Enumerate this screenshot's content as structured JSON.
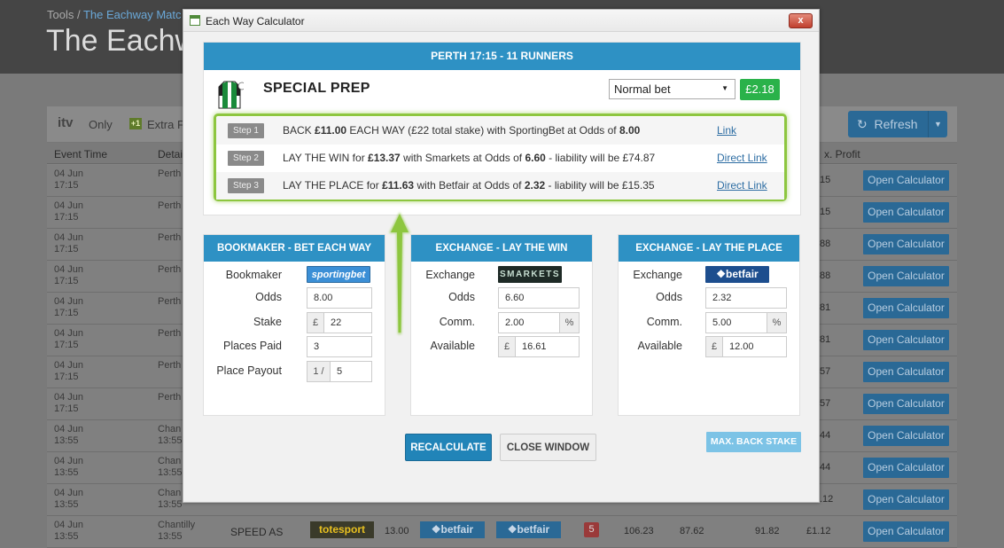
{
  "page": {
    "breadcrumb_root": "Tools",
    "breadcrumb_sep": " / ",
    "breadcrumb_current": "The Eachway Matc",
    "title": "The Eachwa"
  },
  "toolbar": {
    "itv_logo": "itv",
    "itv_only": "Only",
    "extra_badge": "+1",
    "extra_label": "Extra F",
    "refresh_label": "Refresh"
  },
  "table": {
    "headers": [
      "Event Time",
      "Detail",
      "x. Profit"
    ],
    "rows": [
      {
        "date": "04 Jun",
        "time": "17:15",
        "detail1": "Perth",
        "detail2": "",
        "profit": "15",
        "action": "Open Calculator"
      },
      {
        "date": "04 Jun",
        "time": "17:15",
        "detail1": "Perth",
        "detail2": "",
        "profit": "15",
        "action": "Open Calculator"
      },
      {
        "date": "04 Jun",
        "time": "17:15",
        "detail1": "Perth",
        "detail2": "",
        "profit": "88",
        "action": "Open Calculator"
      },
      {
        "date": "04 Jun",
        "time": "17:15",
        "detail1": "Perth",
        "detail2": "",
        "profit": "88",
        "action": "Open Calculator"
      },
      {
        "date": "04 Jun",
        "time": "17:15",
        "detail1": "Perth",
        "detail2": "",
        "profit": "81",
        "action": "Open Calculator"
      },
      {
        "date": "04 Jun",
        "time": "17:15",
        "detail1": "Perth",
        "detail2": "",
        "profit": "81",
        "action": "Open Calculator"
      },
      {
        "date": "04 Jun",
        "time": "17:15",
        "detail1": "Perth",
        "detail2": "",
        "profit": "57",
        "action": "Open Calculator"
      },
      {
        "date": "04 Jun",
        "time": "17:15",
        "detail1": "Perth",
        "detail2": "",
        "profit": "57",
        "action": "Open Calculator"
      },
      {
        "date": "04 Jun",
        "time": "13:55",
        "detail1": "Chan",
        "detail2": "13:55",
        "profit": "44",
        "action": "Open Calculator"
      },
      {
        "date": "04 Jun",
        "time": "13:55",
        "detail1": "Chan",
        "detail2": "13:55",
        "profit": "44",
        "action": "Open Calculator"
      },
      {
        "date": "04 Jun",
        "time": "13:55",
        "detail1": "Chan",
        "detail2": "13:55",
        "profit": ".12",
        "action": "Open Calculator"
      }
    ],
    "last_row": {
      "date": "04 Jun",
      "time": "13:55",
      "course": "Chantilly",
      "course_time": "13:55",
      "horse": "SPEED AS",
      "bookie": "totesport",
      "odds": "13.00",
      "ex1": "betfair",
      "ex2": "betfair",
      "places": "5",
      "v1": "106.23",
      "v2": "87.62",
      "v3": "91.82",
      "profit": "£1.12",
      "action": "Open Calculator"
    }
  },
  "modal": {
    "title": "Each Way Calculator",
    "close": "x",
    "race": "PERTH 17:15  -  11 RUNNERS",
    "horse": "SPECIAL PREP",
    "bet_type": "Normal bet",
    "profit": "£2.18",
    "steps": [
      {
        "label": "Step 1",
        "pre": "BACK ",
        "b1": "£11.00",
        "mid1": " EACH WAY (£22 total stake) with SportingBet at Odds of ",
        "b2": "8.00",
        "post": "",
        "link": "Link"
      },
      {
        "label": "Step 2",
        "pre": "LAY THE WIN for ",
        "b1": "£13.37",
        "mid1": " with Smarkets at Odds of ",
        "b2": "6.60",
        "post": " - liability will be £74.87",
        "link": "Direct Link"
      },
      {
        "label": "Step 3",
        "pre": "LAY THE PLACE for ",
        "b1": "£11.63",
        "mid1": " with Betfair at Odds of ",
        "b2": "2.32",
        "post": " - liability will be £15.35",
        "link": "Direct Link"
      }
    ],
    "bookmaker_panel": {
      "header": "BOOKMAKER - BET EACH WAY",
      "bookmaker_label": "Bookmaker",
      "bookmaker_logo": "sportingbet",
      "odds_label": "Odds",
      "odds_value": "8.00",
      "stake_label": "Stake",
      "stake_prefix": "£",
      "stake_value": "22",
      "places_label": "Places Paid",
      "places_value": "3",
      "payout_label": "Place Payout",
      "payout_prefix": "1 /",
      "payout_value": "5"
    },
    "win_panel": {
      "header": "EXCHANGE - LAY THE WIN",
      "exchange_label": "Exchange",
      "exchange_logo": "SMARKETS",
      "odds_label": "Odds",
      "odds_value": "6.60",
      "comm_label": "Comm.",
      "comm_value": "2.00",
      "comm_suffix": "%",
      "avail_label": "Available",
      "avail_prefix": "£",
      "avail_value": "16.61"
    },
    "place_panel": {
      "header": "EXCHANGE - LAY THE PLACE",
      "exchange_label": "Exchange",
      "exchange_logo": "betfair",
      "odds_label": "Odds",
      "odds_value": "2.32",
      "comm_label": "Comm.",
      "comm_value": "5.00",
      "comm_suffix": "%",
      "avail_label": "Available",
      "avail_prefix": "£",
      "avail_value": "12.00"
    },
    "recalculate": "RECALCULATE",
    "close_window": "CLOSE WINDOW",
    "max_back_stake": "MAX. BACK STAKE"
  },
  "colors": {
    "primary": "#2e91c4",
    "success": "#2ab24a",
    "highlight": "#8dc63f"
  }
}
